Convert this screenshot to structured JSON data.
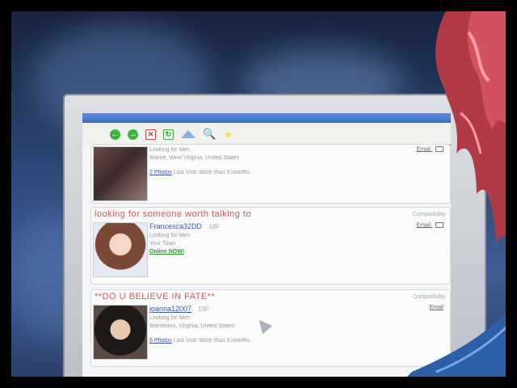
{
  "profiles": [
    {
      "headline": "",
      "compatibility": "",
      "username": "",
      "age": "",
      "looking_for": "Looking for Men",
      "location": "Warne, West Virginia, United States",
      "photos_label": "2 Photos",
      "last_visit": "Last Visit: More than 3 months",
      "email_label": "Email",
      "online_label": ""
    },
    {
      "headline": "looking for someone worth talking to",
      "compatibility": "Compatibility:",
      "username": "Francesca32DD",
      "age": "18F",
      "looking_for": "Looking for Men",
      "location": "Your Town",
      "photos_label": "",
      "last_visit": "",
      "email_label": "Email",
      "online_label": "Online NOW!"
    },
    {
      "headline": "**DO U BELIEVE IN FATE**",
      "compatibility": "Compatibility:",
      "username": "joanna12007",
      "age": "19F",
      "looking_for": "Looking for Men",
      "location": "Warrenton, Virginia, United States",
      "photos_label": "6 Photos",
      "last_visit": "Last Visit: More than 3 months",
      "email_label": "Email",
      "online_label": ""
    }
  ],
  "colors": {
    "headline": "#c85a5a",
    "username": "#3a58a8",
    "online": "#2a9a2a",
    "browser_titlebar": "#3a6dbf"
  }
}
